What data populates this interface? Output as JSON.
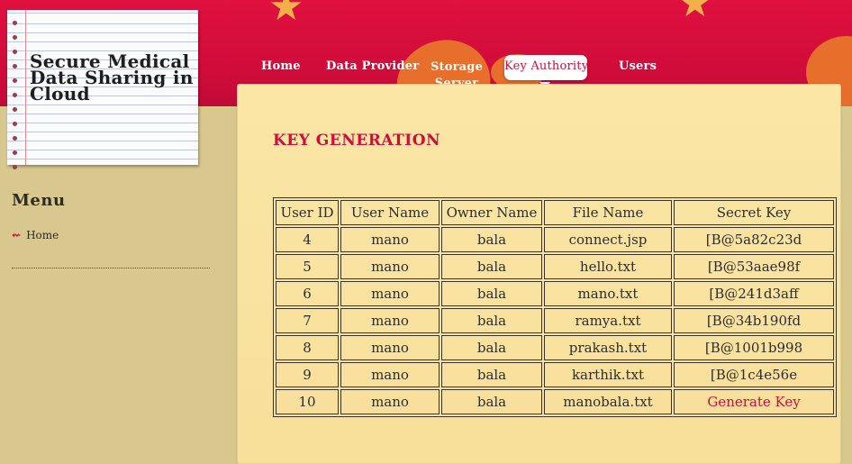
{
  "logo": {
    "title": "Secure Medical Data Sharing in Cloud"
  },
  "nav": {
    "home": "Home",
    "data_provider": "Data Provider",
    "storage_server": "Storage Server",
    "key_authority": "Key Authority",
    "users": "Users"
  },
  "sidebar": {
    "heading": "Menu",
    "home": "Home"
  },
  "content": {
    "title": "KEY GENERATION",
    "table": {
      "headers": [
        "User ID",
        "User Name",
        "Owner Name",
        "File Name",
        "Secret Key"
      ],
      "rows": [
        [
          "4",
          "mano",
          "bala",
          "connect.jsp",
          "[B@5a82c23d"
        ],
        [
          "5",
          "mano",
          "bala",
          "hello.txt",
          "[B@53aae98f"
        ],
        [
          "6",
          "mano",
          "bala",
          "mano.txt",
          "[B@241d3aff"
        ],
        [
          "7",
          "mano",
          "bala",
          "ramya.txt",
          "[B@34b190fd"
        ],
        [
          "8",
          "mano",
          "bala",
          "prakash.txt",
          "[B@1001b998"
        ],
        [
          "9",
          "mano",
          "bala",
          "karthik.txt",
          "[B@1c4e56e"
        ],
        [
          "10",
          "mano",
          "bala",
          "manobala.txt",
          "Generate Key"
        ]
      ]
    }
  },
  "colors": {
    "accent": "#cf0c3a",
    "panel": "#fbe6a6",
    "sidebar": "#d8c88e"
  },
  "icons": {
    "menu_bullet": "double-arrow-icon"
  }
}
